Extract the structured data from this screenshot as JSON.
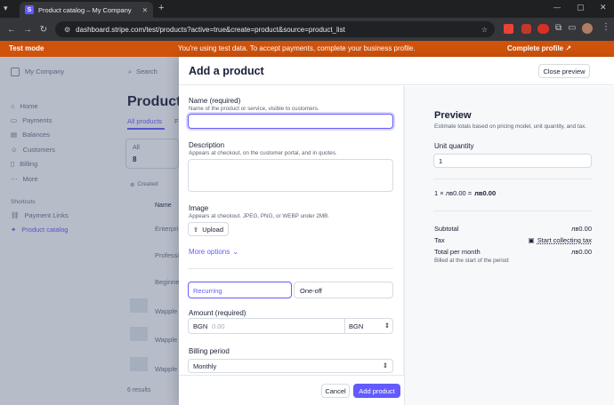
{
  "browser": {
    "tab_title": "Product catalog – My Company",
    "favicon": "S",
    "new_tab": "+",
    "url": "dashboard.stripe.com/test/products?active=true&create=product&source=product_list"
  },
  "testbar": {
    "mode": "Test mode",
    "message": "You're using test data. To accept payments, complete your business profile.",
    "cta": "Complete profile"
  },
  "dashboard": {
    "company": "My Company",
    "search": "Search",
    "nav": [
      "Home",
      "Payments",
      "Balances",
      "Customers",
      "Billing",
      "More"
    ],
    "shortcuts_title": "Shortcuts",
    "shortcuts": [
      "Payment Links",
      "Product catalog"
    ],
    "page_title": "Product",
    "tab_all": "All products",
    "tab_f": "F",
    "stat_label": "All",
    "stat_value": "8",
    "filter_created": "Created",
    "col_name": "Name",
    "rows": [
      "Enterpri",
      "Professi",
      "Beginne",
      "Wapple",
      "Wapple",
      "Wapple"
    ],
    "results": "6 results"
  },
  "modal": {
    "title": "Add a product",
    "close_preview": "Close preview",
    "name_label": "Name (required)",
    "name_hint": "Name of the product or service, visible to customers.",
    "name_value": "",
    "desc_label": "Description",
    "desc_hint": "Appears at checkout, on the customer portal, and in quotes.",
    "image_label": "Image",
    "image_hint": "Appears at checkout. JPEG, PNG, or WEBP under 2MB.",
    "upload": "Upload",
    "more_options": "More options",
    "recurring": "Recurring",
    "oneoff": "One-off",
    "amount_label": "Amount (required)",
    "currency_prefix": "BGN",
    "amount_placeholder": "0.00",
    "currency_select": "BGN",
    "billing_label": "Billing period",
    "billing_value": "Monthly",
    "cancel": "Cancel",
    "add_product": "Add product"
  },
  "preview": {
    "title": "Preview",
    "subtitle": "Estimate totals based on pricing model, unit quantity, and tax.",
    "qty_label": "Unit quantity",
    "qty_value": "1",
    "calc_left": "1 × лв0.00 =",
    "calc_right": "лв0.00",
    "subtotal_label": "Subtotal",
    "subtotal_value": "лв0.00",
    "tax_label": "Tax",
    "tax_link": "Start collecting tax",
    "total_label": "Total per month",
    "total_value": "лв0.00",
    "billed_note": "Billed at the start of the period"
  },
  "colors": {
    "accent": "#635bff",
    "testbar": "#d0530b",
    "focus": "#635bff"
  }
}
